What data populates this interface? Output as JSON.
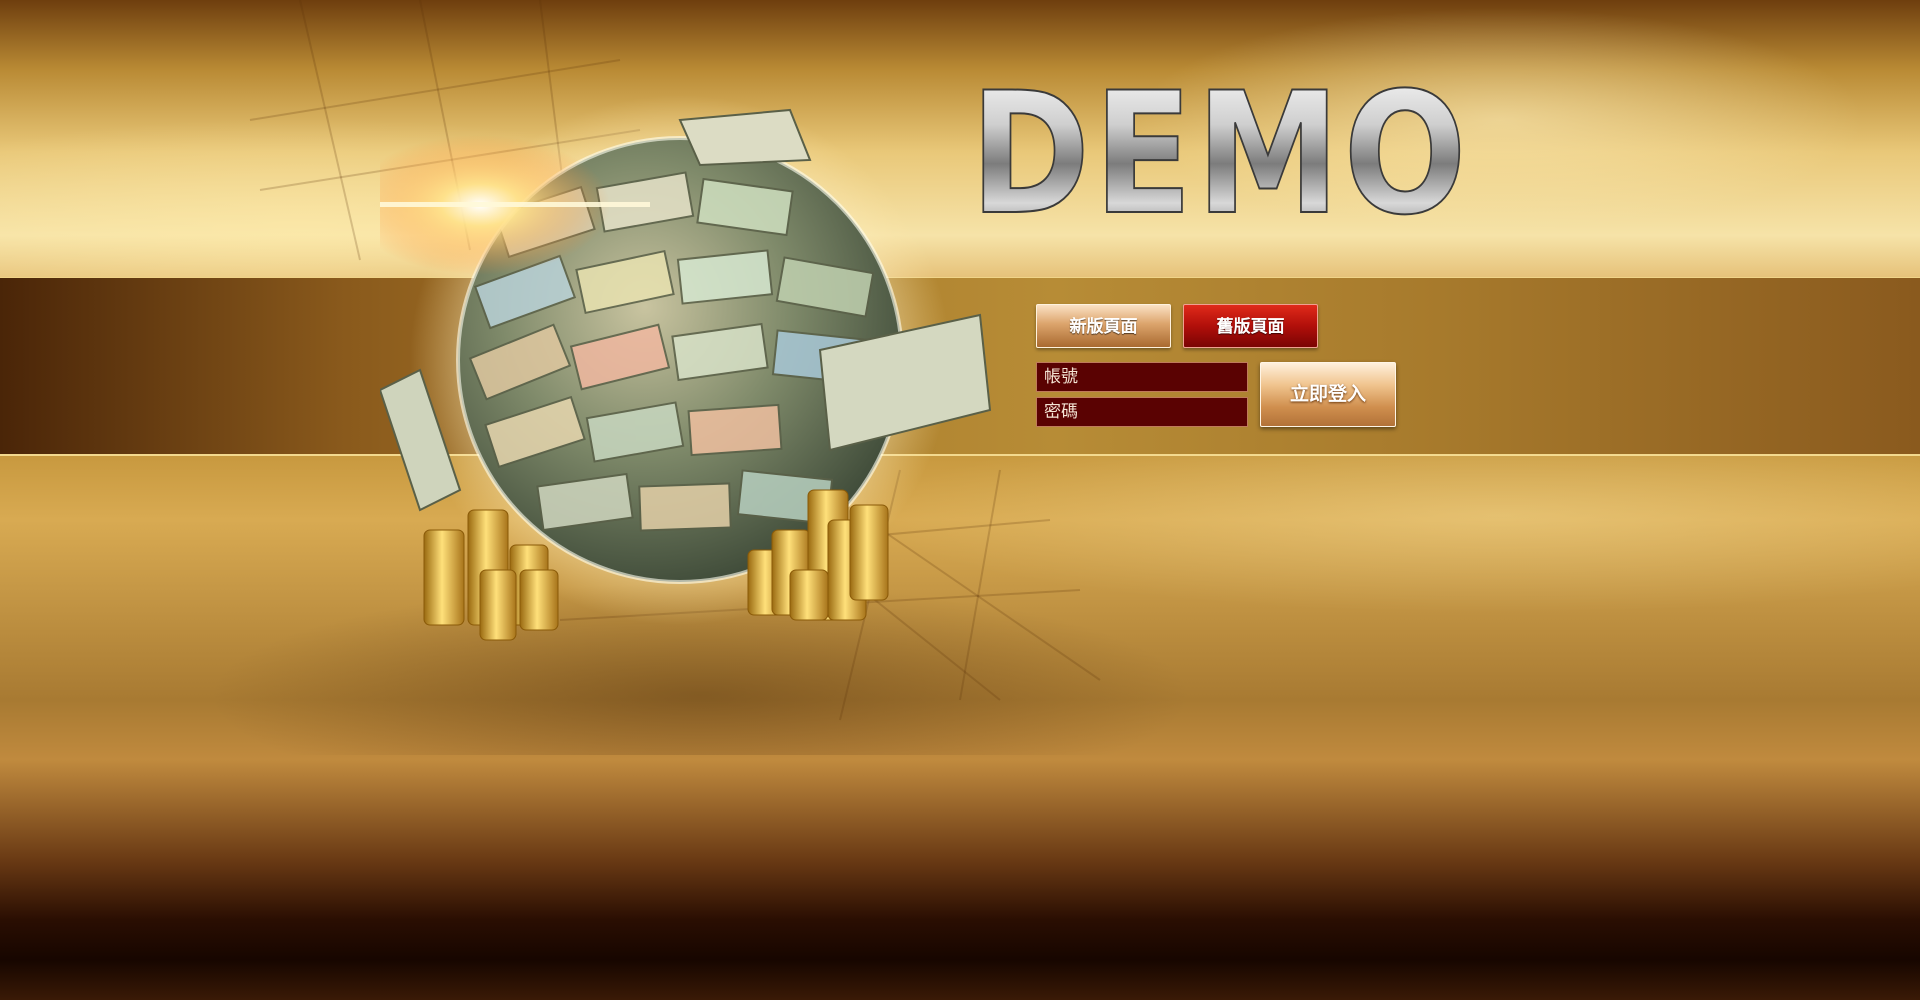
{
  "brand": {
    "logo_text": "DEMO"
  },
  "version_switch": {
    "new_label": "新版頁面",
    "old_label": "舊版頁面"
  },
  "login": {
    "username_placeholder": "帳號",
    "password_placeholder": "密碼",
    "submit_label": "立即登入"
  },
  "colors": {
    "gold_accent": "#d8aa52",
    "field_bg": "#5a0202",
    "old_button_red": "#b10f0a",
    "new_button_gold": "#dca46c"
  }
}
